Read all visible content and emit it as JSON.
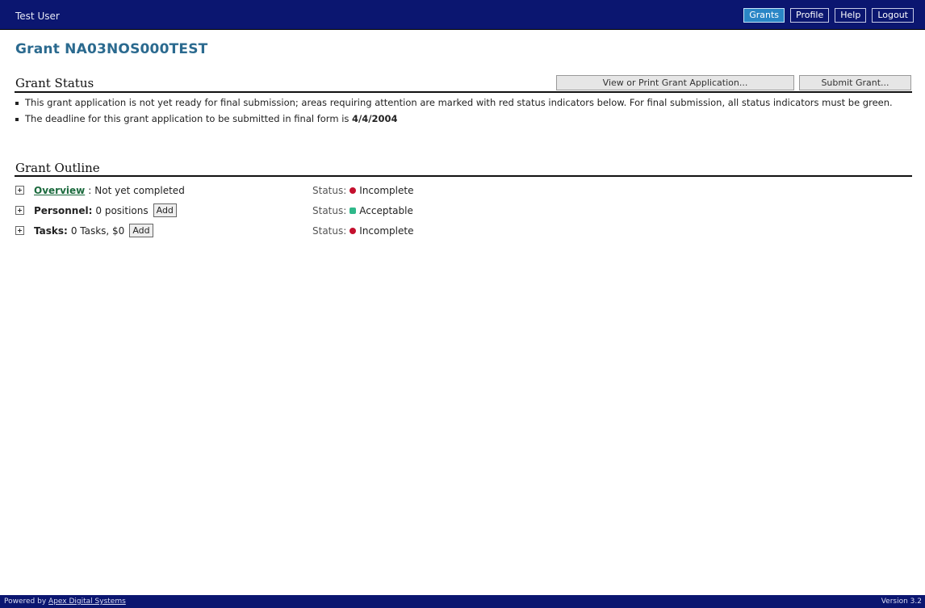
{
  "header": {
    "user": "Test User",
    "nav": [
      {
        "label": "Grants",
        "active": true
      },
      {
        "label": "Profile",
        "active": false
      },
      {
        "label": "Help",
        "active": false
      },
      {
        "label": "Logout",
        "active": false
      }
    ]
  },
  "page": {
    "title": "Grant NA03NOS000TEST"
  },
  "grant_status": {
    "heading": "Grant Status",
    "view_button": "View or Print Grant Application...",
    "submit_button": "Submit Grant...",
    "notes": {
      "readiness": "This grant application is not yet ready for final submission; areas requiring attention are marked with red status indicators below. For final submission, all status indicators must be green.",
      "deadline_prefix": "The deadline for this grant application to be submitted in final form is",
      "deadline_date": "4/4/2004"
    }
  },
  "outline": {
    "heading": "Grant Outline",
    "status_label": "Status:",
    "rows": [
      {
        "label": "Overview",
        "sep": ":",
        "detail": "Not yet completed",
        "status": "Incomplete",
        "status_color": "#c4102e"
      },
      {
        "label": "Personnel:",
        "detail": "0 positions",
        "add": "Add",
        "status": "Acceptable",
        "status_color": "#2fb88a"
      },
      {
        "label": "Tasks:",
        "detail": "0 Tasks, $0",
        "add": "Add",
        "status": "Incomplete",
        "status_color": "#c4102e"
      }
    ]
  },
  "footer": {
    "powered_prefix": "Powered by",
    "powered_link": "Apex Digital Systems",
    "version": "Version 3.2"
  },
  "colors": {
    "header_bg": "#0b1670",
    "active_tab": "#2a86c6",
    "title_color": "#2b6a8f"
  }
}
